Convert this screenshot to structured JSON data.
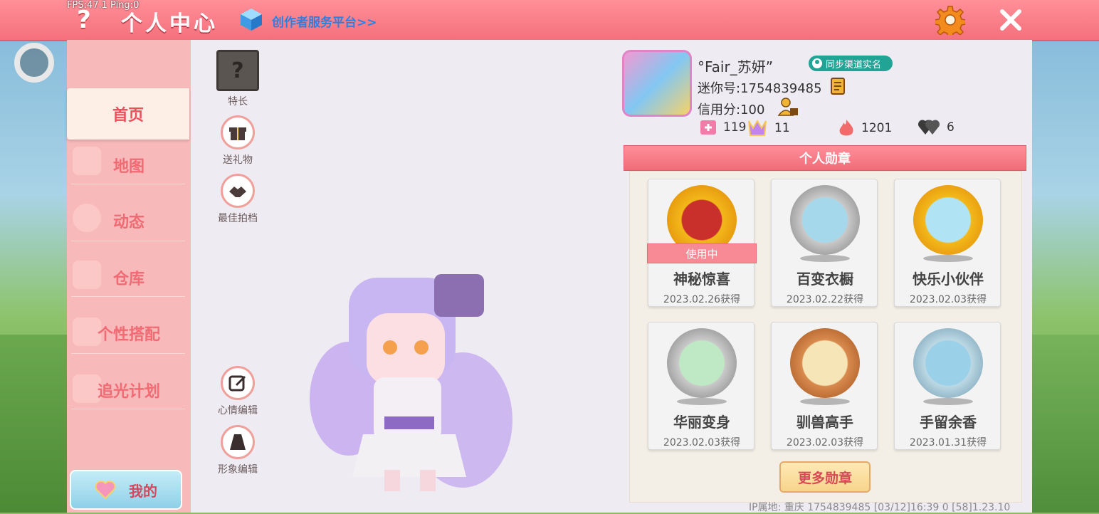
{
  "debug": {
    "fps_text": "FPS:47.1 Ping:0"
  },
  "header": {
    "help": "?",
    "title": "个人中心",
    "creator_link": "创作者服务平台>>"
  },
  "sidebar": {
    "items": [
      {
        "label": "首页",
        "active": true
      },
      {
        "label": "地图"
      },
      {
        "label": "动态"
      },
      {
        "label": "仓库"
      },
      {
        "label": "个性搭配"
      },
      {
        "label": "追光计划"
      }
    ],
    "my_button": "我的"
  },
  "actions": {
    "specialty": "特长",
    "send_gift": "送礼物",
    "best_partner": "最佳拍档",
    "mood_edit": "心情编辑",
    "image_edit": "形象编辑"
  },
  "profile": {
    "nickname": "°Fair_苏妍”",
    "realname_badge": "同步渠道实名",
    "mini_id": "迷你号:1754839485",
    "credit": "信用分:100",
    "stats": {
      "flag": "119",
      "fans": "11",
      "heat": "1201",
      "likes": "6"
    }
  },
  "medals": {
    "header": "个人勋章",
    "in_use_label": "使用中",
    "items": [
      {
        "name": "神秘惊喜",
        "date": "2023.02.26获得",
        "in_use": true,
        "tier": "gold"
      },
      {
        "name": "百变衣橱",
        "date": "2023.02.22获得",
        "tier": "silver"
      },
      {
        "name": "快乐小伙伴",
        "date": "2023.02.03获得",
        "tier": "gold"
      },
      {
        "name": "华丽变身",
        "date": "2023.02.03获得",
        "tier": "silver"
      },
      {
        "name": "驯兽高手",
        "date": "2023.02.03获得",
        "tier": "bronze"
      },
      {
        "name": "手留余香",
        "date": "2023.01.31获得",
        "tier": "blue"
      }
    ],
    "more_button": "更多勋章"
  },
  "footer": {
    "text": "IP属地: 重庆   1754839485   [03/12]16:39 0   [58]1.23.10"
  },
  "colors": {
    "topbar": "#f4707c",
    "sidebar": "#f8b9ba",
    "accent": "#ea4f5c",
    "link": "#2e7fe0",
    "badge": "#21a496"
  }
}
